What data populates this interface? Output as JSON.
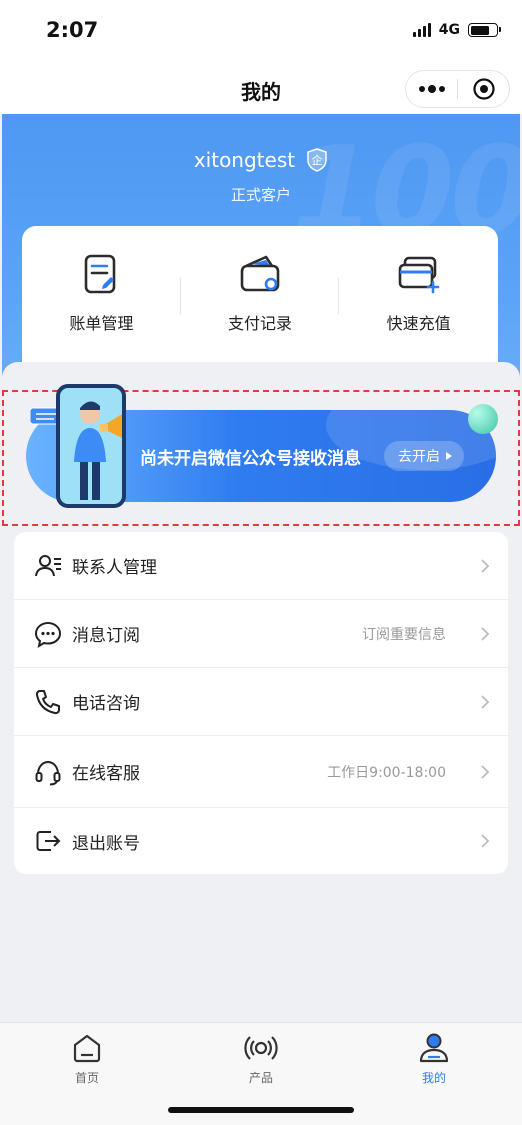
{
  "status_bar": {
    "time": "2:07",
    "network": "4G"
  },
  "nav": {
    "title": "我的"
  },
  "profile": {
    "name": "xitongtest",
    "badge": "企",
    "level": "正式客户"
  },
  "quick_actions": [
    {
      "label": "账单管理",
      "icon": "bill-icon"
    },
    {
      "label": "支付记录",
      "icon": "wallet-icon"
    },
    {
      "label": "快速充值",
      "icon": "card-plus-icon"
    }
  ],
  "banner": {
    "text": "尚未开启微信公众号接收消息",
    "button": "去开启"
  },
  "menu": [
    {
      "label": "联系人管理",
      "hint": "",
      "icon": "contacts-icon"
    },
    {
      "label": "消息订阅",
      "hint": "订阅重要信息",
      "icon": "message-icon"
    },
    {
      "label": "电话咨询",
      "hint": "",
      "icon": "phone-icon"
    },
    {
      "label": "在线客服",
      "hint": "工作日9:00-18:00",
      "icon": "headset-icon"
    },
    {
      "label": "退出账号",
      "hint": "",
      "icon": "logout-icon"
    }
  ],
  "tabbar": [
    {
      "label": "首页",
      "icon": "home-icon",
      "active": false
    },
    {
      "label": "产品",
      "icon": "broadcast-icon",
      "active": false
    },
    {
      "label": "我的",
      "icon": "user-icon",
      "active": true
    }
  ],
  "colors": {
    "accent": "#2f7cf0",
    "hero": "#4f98f3",
    "highlight_border": "#e23b3b"
  }
}
